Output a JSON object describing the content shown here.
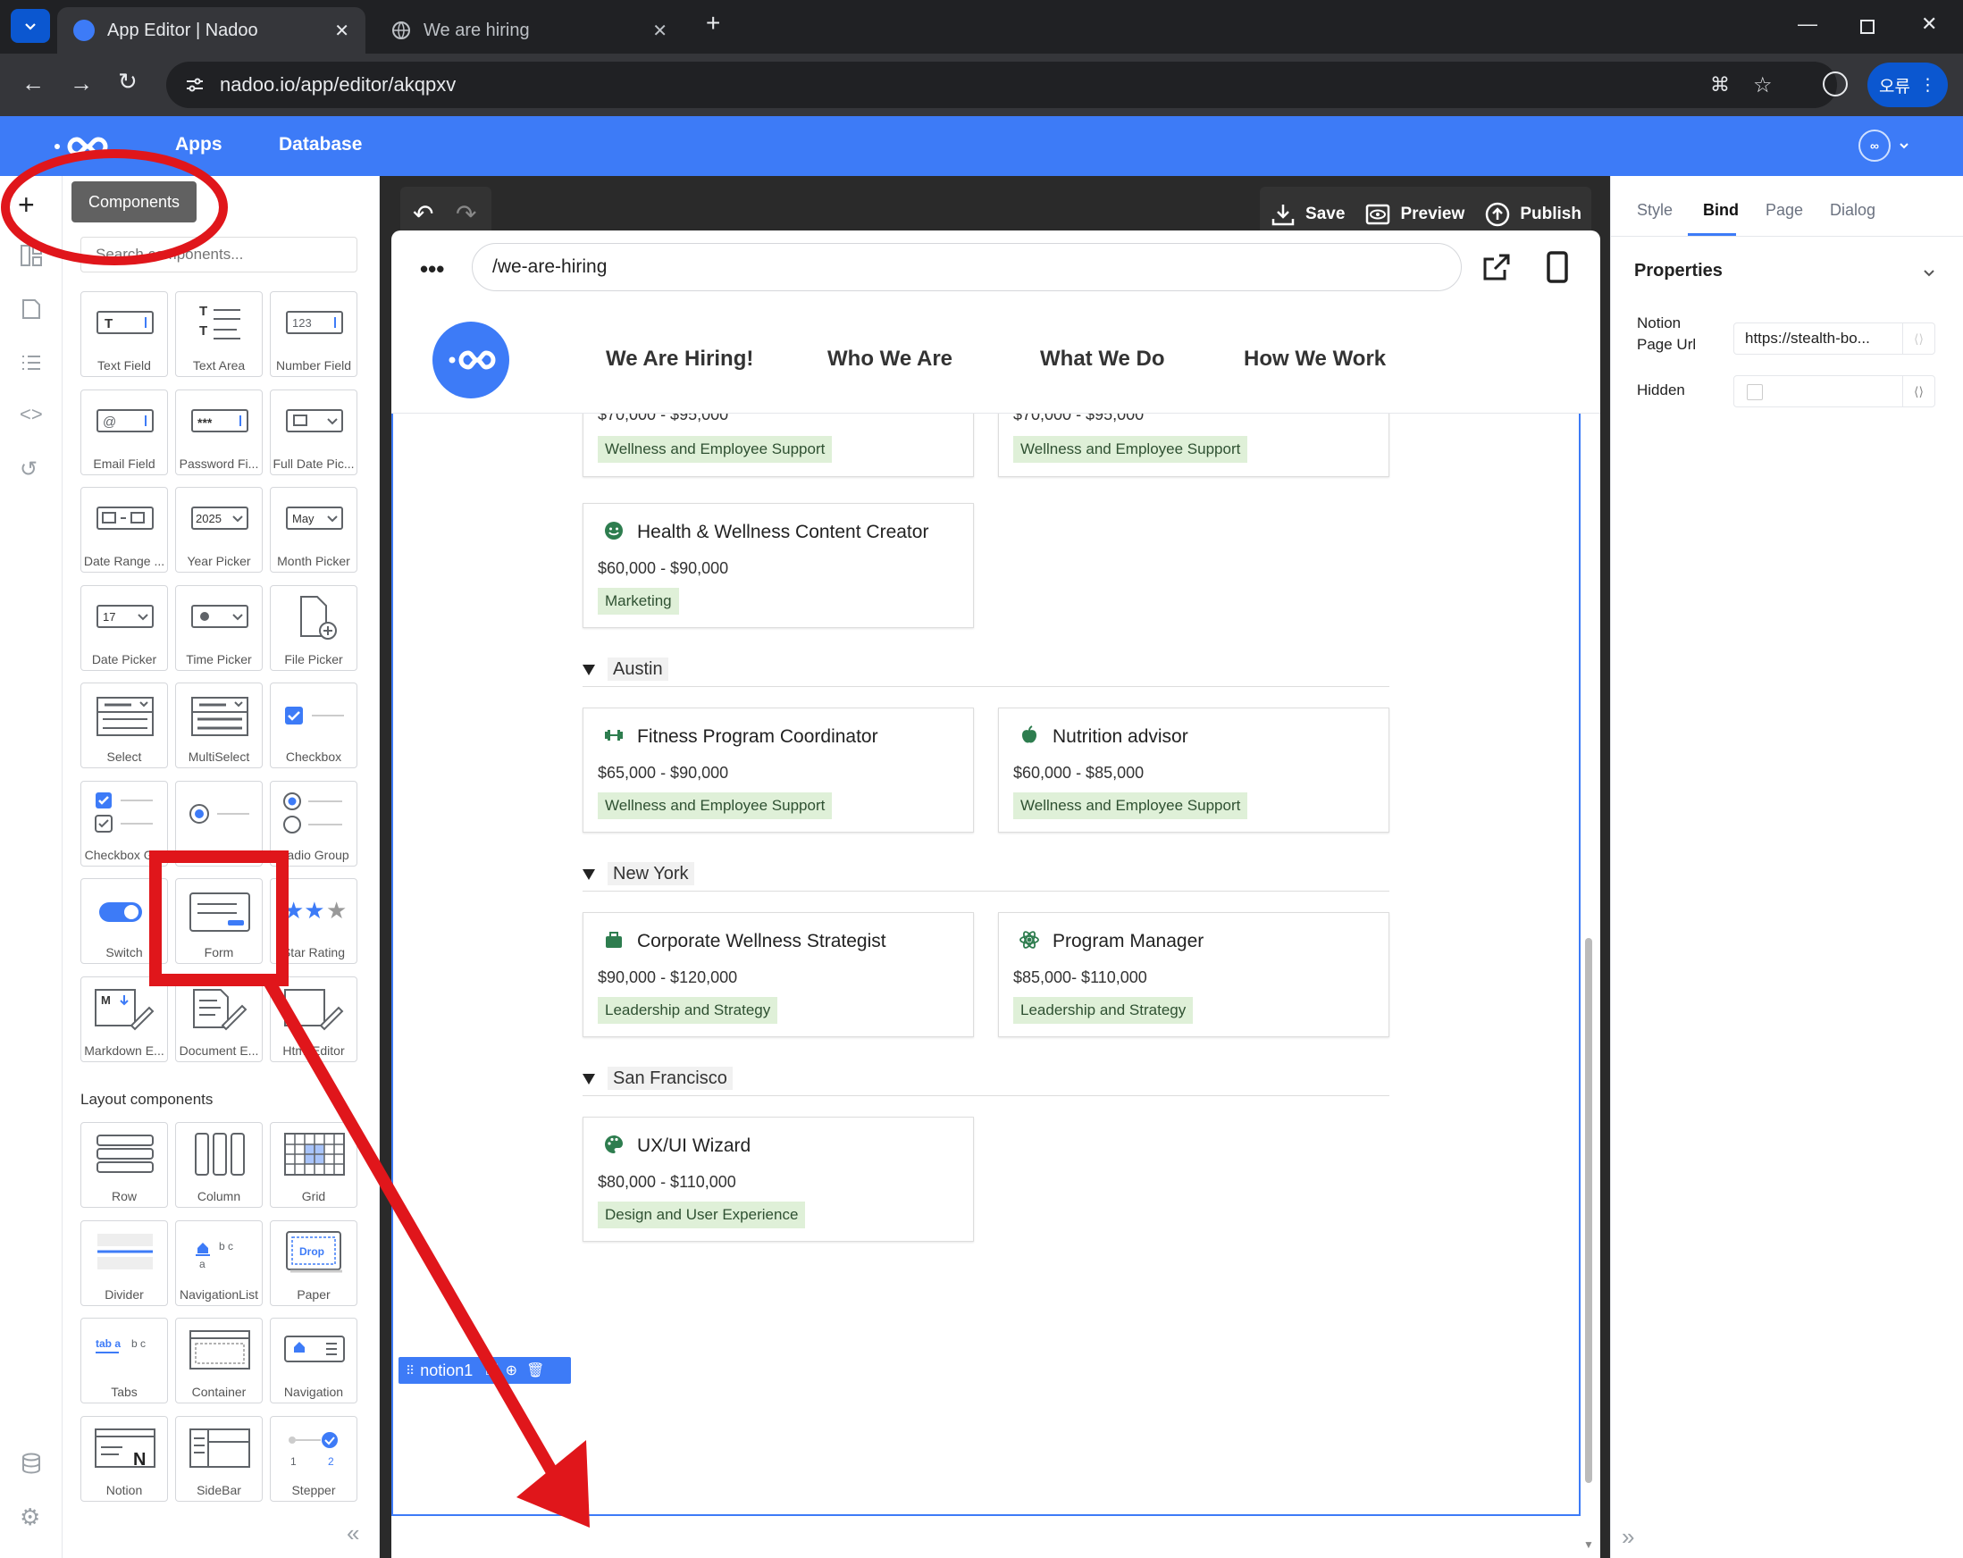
{
  "browser": {
    "tabs": [
      {
        "label": "App Editor | Nadoo",
        "active": true
      },
      {
        "label": "We are hiring",
        "active": false
      }
    ],
    "url": "nadoo.io/app/editor/akqpxv",
    "profile_label": "오류"
  },
  "app": {
    "nav": [
      "Apps",
      "Database"
    ]
  },
  "left_panel": {
    "tooltip": "Components",
    "search_placeholder": "Search components...",
    "components": [
      "Text Field",
      "Text Area",
      "Number Field",
      "Email Field",
      "Password Fi...",
      "Full Date Pic...",
      "Date Range ...",
      "Year Picker",
      "Month Picker",
      "Date Picker",
      "Time Picker",
      "File Picker",
      "Select",
      "MultiSelect",
      "Checkbox",
      "Checkbox G...",
      "Radio",
      "Radio Group",
      "Switch",
      "Form",
      "Star Rating",
      "Markdown E...",
      "Document E...",
      "Html Editor"
    ],
    "icon_text": {
      "number": "123",
      "password": "***",
      "year": "2025",
      "month": "May",
      "date": "17",
      "markdown": "M",
      "drop": "Drop",
      "tabs_a": "tab a",
      "tabs_bc": "b  c",
      "nav_bc": "b  c",
      "nav_a": "a",
      "notion": "N",
      "stepper_1": "1",
      "stepper_2": "2"
    },
    "layout_title": "Layout components",
    "layout_components": [
      "Row",
      "Column",
      "Grid",
      "Divider",
      "NavigationList",
      "Paper",
      "Tabs",
      "Container",
      "Navigation",
      "Notion",
      "SideBar",
      "Stepper"
    ]
  },
  "toolbar": {
    "save": "Save",
    "preview": "Preview",
    "publish": "Publish"
  },
  "page_url": "/we-are-hiring",
  "site": {
    "nav": [
      "We Are Hiring!",
      "Who We Are",
      "What We Do",
      "How We Work"
    ]
  },
  "jobs": {
    "top_partial": [
      {
        "salary": "$70,000 - $95,000",
        "tag": "Wellness and Employee Support"
      },
      {
        "salary": "$70,000 - $95,000",
        "tag": "Wellness and Employee Support"
      }
    ],
    "health": {
      "title": "Health & Wellness Content Creator",
      "salary": "$60,000 - $90,000",
      "tag": "Marketing"
    },
    "groups": [
      {
        "name": "Austin",
        "cards": [
          {
            "title": "Fitness Program Coordinator",
            "salary": "$65,000 - $90,000",
            "tag": "Wellness and Employee Support",
            "icon": "dumbbell-icon"
          },
          {
            "title": "Nutrition advisor",
            "salary": "$60,000 - $85,000",
            "tag": "Wellness and Employee Support",
            "icon": "apple-icon"
          }
        ]
      },
      {
        "name": "New York",
        "cards": [
          {
            "title": "Corporate Wellness Strategist",
            "salary": "$90,000 - $120,000",
            "tag": "Leadership and Strategy",
            "icon": "briefcase-icon"
          },
          {
            "title": "Program Manager",
            "salary": "$85,000- $110,000",
            "tag": "Leadership and Strategy",
            "icon": "atom-icon"
          }
        ]
      },
      {
        "name": "San Francisco",
        "cards": [
          {
            "title": "UX/UI Wizard",
            "salary": "$80,000 - $110,000",
            "tag": "Design and User Experience",
            "icon": "palette-icon"
          }
        ]
      }
    ]
  },
  "selection_label": "notion1",
  "right_panel": {
    "tabs": [
      "Style",
      "Bind",
      "Page",
      "Dialog"
    ],
    "active_tab": "Bind",
    "section": "Properties",
    "fields": [
      {
        "label": "Notion\nPage Url",
        "value": "https://stealth-bo..."
      },
      {
        "label": "Hidden",
        "value": ""
      }
    ]
  },
  "colors": {
    "brand": "#3d7bf7",
    "annotation": "#e0161b",
    "tag_bg": "#dff0d8",
    "icon_green": "#2e7d4f"
  }
}
